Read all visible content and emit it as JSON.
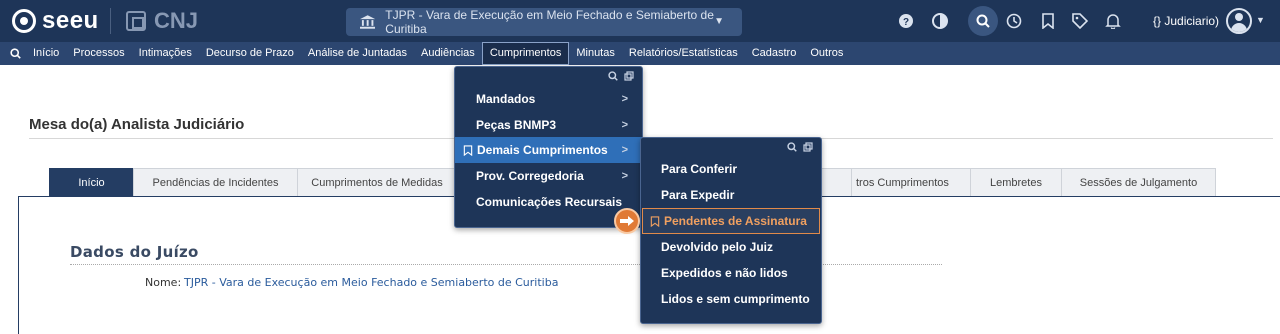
{
  "header": {
    "logo_text": "seeu",
    "cnj_text": "CNJ",
    "court": "TJPR - Vara de Execução em Meio Fechado e Semiaberto de Curitiba",
    "user": "{} Judiciario)"
  },
  "menubar": {
    "items": [
      "Início",
      "Processos",
      "Intimações",
      "Decurso de Prazo",
      "Análise de Juntadas",
      "Audiências",
      "Cumprimentos",
      "Minutas",
      "Relatórios/Estatísticas",
      "Cadastro",
      "Outros"
    ],
    "active": "Cumprimentos"
  },
  "page": {
    "title": "Mesa do(a) Analista Judiciário",
    "tabs": [
      "Início",
      "Pendências de Incidentes",
      "Cumprimentos de Medidas",
      "",
      "",
      "",
      "",
      "tros Cumprimentos",
      "Lembretes",
      "Sessões de Julgamento"
    ],
    "dados_title": "Dados do Juízo",
    "nome_label": "Nome:",
    "nome_value": "TJPR - Vara de Execução em Meio Fechado e Semiaberto de Curitiba"
  },
  "dropdown1": {
    "items": [
      "Mandados",
      "Peças BNMP3",
      "Demais Cumprimentos",
      "Prov. Corregedoria",
      "Comunicações Recursais"
    ],
    "highlighted": "Demais Cumprimentos"
  },
  "dropdown2": {
    "items": [
      "Para Conferir",
      "Para Expedir",
      "Pendentes de Assinatura",
      "Devolvido pelo Juiz",
      "Expedidos e não lidos",
      "Lidos e sem cumprimento"
    ],
    "highlighted": "Pendentes de Assinatura"
  },
  "colors": {
    "topbar": "#1e3558",
    "menubar": "#2c4670",
    "highlight_blue": "#2f6fb8",
    "pointer_orange": "#e07a36"
  },
  "icons": [
    "seeu-logo-icon",
    "cnj-logo-icon",
    "building-icon",
    "chevron-down-icon",
    "help-icon",
    "contrast-icon",
    "search-icon",
    "history-icon",
    "bookmark-icon",
    "tag-icon",
    "bell-icon",
    "user-avatar-icon",
    "pointer-hand-icon"
  ]
}
